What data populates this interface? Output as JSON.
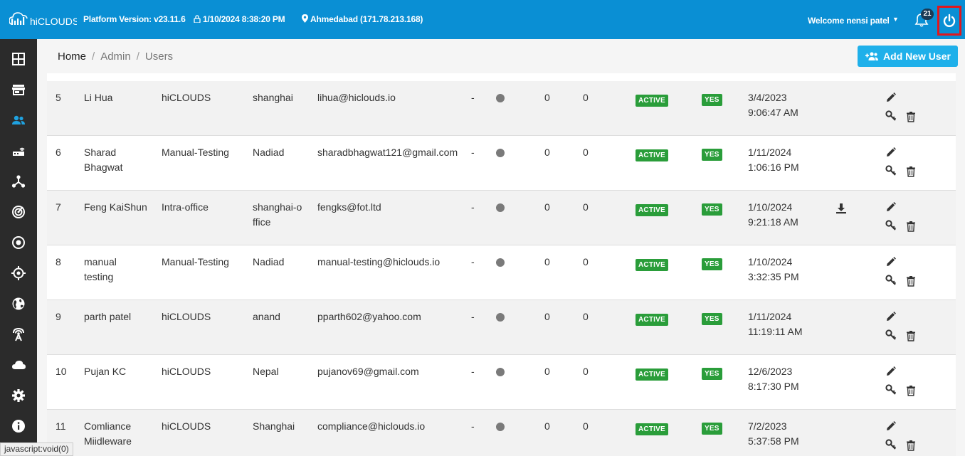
{
  "header": {
    "logo_text": "hiCLOUDS",
    "platform_version": "Platform Version: v23.11.6",
    "datetime": "1/10/2024 8:38:20 PM",
    "location": "Ahmedabad (171.78.213.168)",
    "welcome": "Welcome nensi patel",
    "notification_count": "21",
    "brand_color": "#0a8fd4"
  },
  "sidebar": {
    "items": [
      {
        "icon": "dashboard-grid-icon"
      },
      {
        "icon": "store-icon"
      },
      {
        "icon": "users-icon",
        "active": true
      },
      {
        "icon": "router-icon"
      },
      {
        "icon": "network-hub-icon"
      },
      {
        "icon": "radar-icon"
      },
      {
        "icon": "target-circle-icon"
      },
      {
        "icon": "crosshair-icon"
      },
      {
        "icon": "globe-icon"
      },
      {
        "icon": "wireless-tower-icon"
      },
      {
        "icon": "cloud-icon"
      },
      {
        "icon": "gear-icon"
      },
      {
        "icon": "info-icon"
      }
    ]
  },
  "breadcrumb": {
    "home": "Home",
    "admin": "Admin",
    "users": "Users",
    "separator": "/"
  },
  "add_user_button": "Add New User",
  "users": [
    {
      "no": "5",
      "name": "Li Hua",
      "group": "hiCLOUDS",
      "location": "shanghai",
      "email": "lihua@hiclouds.io",
      "dash": "-",
      "c1": "0",
      "c2": "0",
      "status": "ACTIVE",
      "flag": "YES",
      "date": "3/4/2023",
      "time": "9:06:47 AM",
      "download": false
    },
    {
      "no": "6",
      "name": "Sharad Bhagwat",
      "group": "Manual-Testing",
      "location": "Nadiad",
      "email": "sharadbhagwat121@gmail.com",
      "dash": "-",
      "c1": "0",
      "c2": "0",
      "status": "ACTIVE",
      "flag": "YES",
      "date": "1/11/2024",
      "time": "1:06:16 PM",
      "download": false
    },
    {
      "no": "7",
      "name": "Feng KaiShun",
      "group": "Intra-office",
      "location": "shanghai-office",
      "email": "fengks@fot.ltd",
      "dash": "-",
      "c1": "0",
      "c2": "0",
      "status": "ACTIVE",
      "flag": "YES",
      "date": "1/10/2024",
      "time": "9:21:18 AM",
      "download": true
    },
    {
      "no": "8",
      "name": "manual testing",
      "group": "Manual-Testing",
      "location": "Nadiad",
      "email": "manual-testing@hiclouds.io",
      "dash": "-",
      "c1": "0",
      "c2": "0",
      "status": "ACTIVE",
      "flag": "YES",
      "date": "1/10/2024",
      "time": "3:32:35 PM",
      "download": false
    },
    {
      "no": "9",
      "name": "parth patel",
      "group": "hiCLOUDS",
      "location": "anand",
      "email": "pparth602@yahoo.com",
      "dash": "-",
      "c1": "0",
      "c2": "0",
      "status": "ACTIVE",
      "flag": "YES",
      "date": "1/11/2024",
      "time": "11:19:11 AM",
      "download": false
    },
    {
      "no": "10",
      "name": "Pujan KC",
      "group": "hiCLOUDS",
      "location": "Nepal",
      "email": "pujanov69@gmail.com",
      "dash": "-",
      "c1": "0",
      "c2": "0",
      "status": "ACTIVE",
      "flag": "YES",
      "date": "12/6/2023",
      "time": "8:17:30 PM",
      "download": false
    },
    {
      "no": "11",
      "name": "Comliance Miidleware",
      "group": "hiCLOUDS",
      "location": "Shanghai",
      "email": "compliance@hiclouds.io",
      "dash": "-",
      "c1": "0",
      "c2": "0",
      "status": "ACTIVE",
      "flag": "YES",
      "date": "7/2/2023",
      "time": "5:37:58 PM",
      "download": false
    }
  ],
  "statusbar_text": "javascript:void(0)"
}
